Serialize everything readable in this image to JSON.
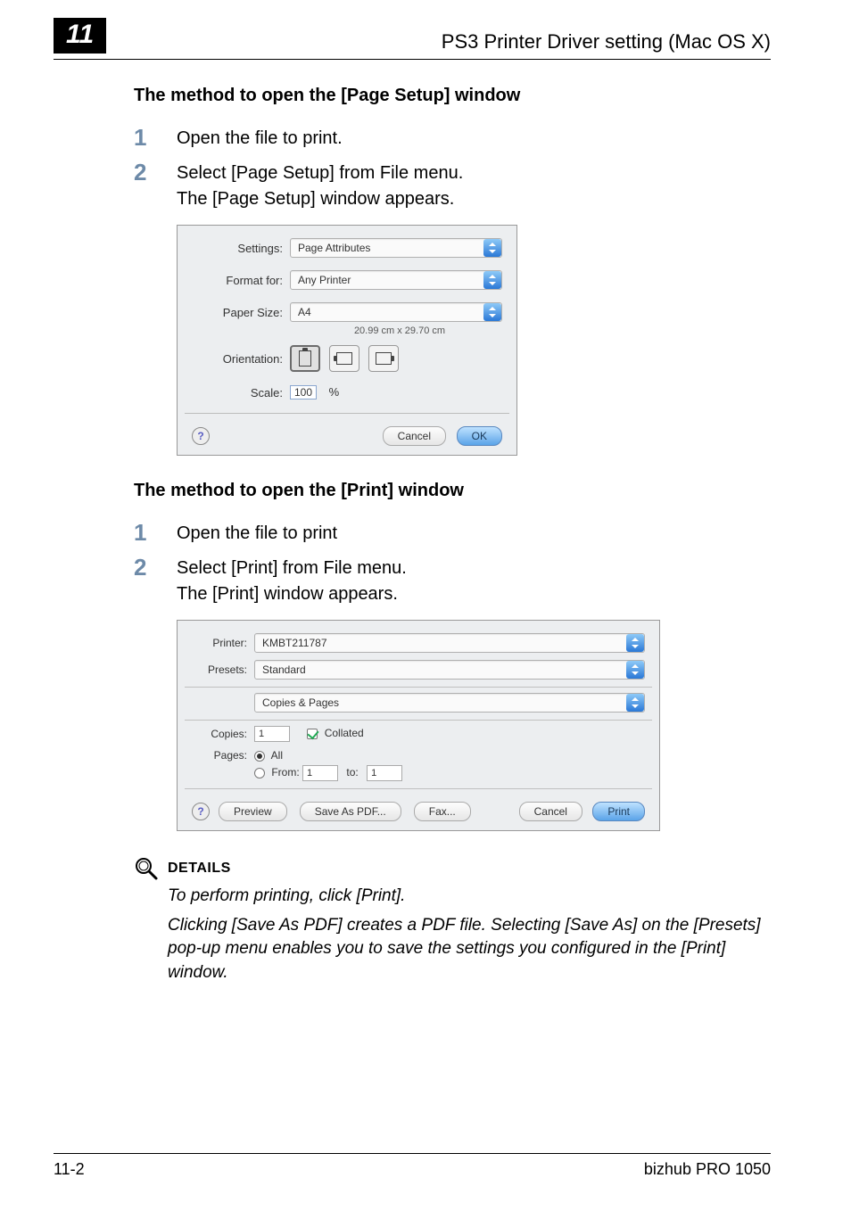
{
  "chapter_number": "11",
  "header_title": "PS3 Printer Driver setting (Mac OS X)",
  "section1": {
    "heading": "The method to open the [Page Setup] window",
    "step1": "Open the file to print.",
    "step2a": "Select [Page Setup] from File menu.",
    "step2b": "The [Page Setup] window appears."
  },
  "page_setup": {
    "settings_label": "Settings:",
    "settings_value": "Page Attributes",
    "format_label": "Format for:",
    "format_value": "Any Printer",
    "paper_label": "Paper Size:",
    "paper_value": "A4",
    "paper_dim": "20.99 cm x 29.70 cm",
    "orient_label": "Orientation:",
    "scale_label": "Scale:",
    "scale_value": "100",
    "scale_pct": "%",
    "cancel": "Cancel",
    "ok": "OK",
    "help": "?"
  },
  "section2": {
    "heading": "The method to open the [Print] window",
    "step1": "Open the file to print",
    "step2a": "Select [Print] from File menu.",
    "step2b": "The [Print] window appears."
  },
  "print": {
    "printer_label": "Printer:",
    "printer_value": "KMBT211787",
    "presets_label": "Presets:",
    "presets_value": "Standard",
    "pane_value": "Copies & Pages",
    "copies_label": "Copies:",
    "copies_value": "1",
    "collated": "Collated",
    "pages_label": "Pages:",
    "all": "All",
    "from": "From:",
    "from_v": "1",
    "to": "to:",
    "to_v": "1",
    "help": "?",
    "preview": "Preview",
    "savepdf": "Save As PDF...",
    "fax": "Fax...",
    "cancel": "Cancel",
    "print_btn": "Print"
  },
  "details": {
    "title": "DETAILS",
    "p1": "To perform printing, click [Print].",
    "p2": "Clicking [Save As PDF] creates a PDF file. Selecting [Save As] on the [Presets] pop-up menu enables you to save the settings you configured in the [Print] window."
  },
  "footer": {
    "page": "11-2",
    "product": "bizhub PRO 1050"
  }
}
